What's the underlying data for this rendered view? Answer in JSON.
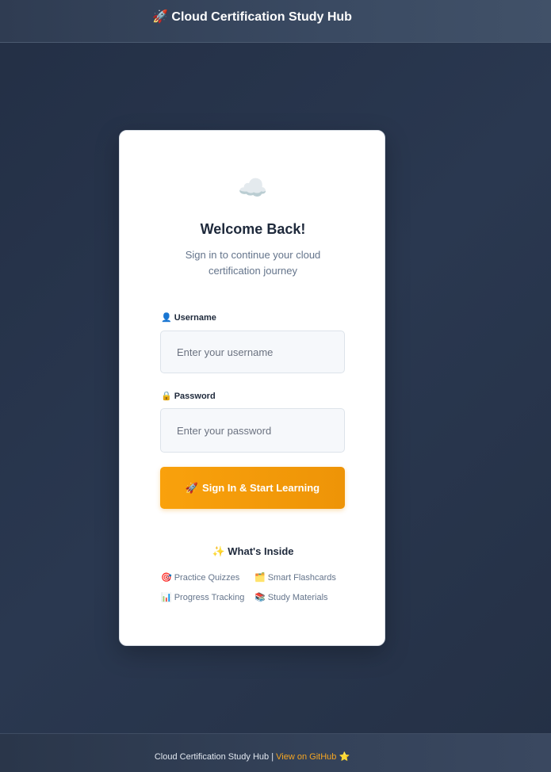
{
  "header": {
    "icon": "🚀",
    "title": "Cloud Certification Study Hub"
  },
  "login": {
    "logo_icon": "☁️",
    "title": "Welcome Back!",
    "subtitle": "Sign in to continue your cloud certification journey",
    "username_icon": "👤",
    "username_label": "Username",
    "username_placeholder": "Enter your username",
    "username_value": "",
    "password_icon": "🔒",
    "password_label": "Password",
    "password_placeholder": "Enter your password",
    "password_value": "",
    "submit_icon": "🚀",
    "submit_label": "Sign In & Start Learning"
  },
  "features": {
    "icon": "✨",
    "title": "What's Inside",
    "items": [
      {
        "icon": "🎯",
        "label": "Practice Quizzes"
      },
      {
        "icon": "🗂️",
        "label": "Smart Flashcards"
      },
      {
        "icon": "📊",
        "label": "Progress Tracking"
      },
      {
        "icon": "📚",
        "label": "Study Materials"
      }
    ]
  },
  "footer": {
    "text": "Cloud Certification Study Hub |",
    "link_label": "View on GitHub",
    "star_icon": "⭐"
  },
  "colors": {
    "accent": "#f59e0b",
    "background": "#243044",
    "card": "#ffffff"
  }
}
